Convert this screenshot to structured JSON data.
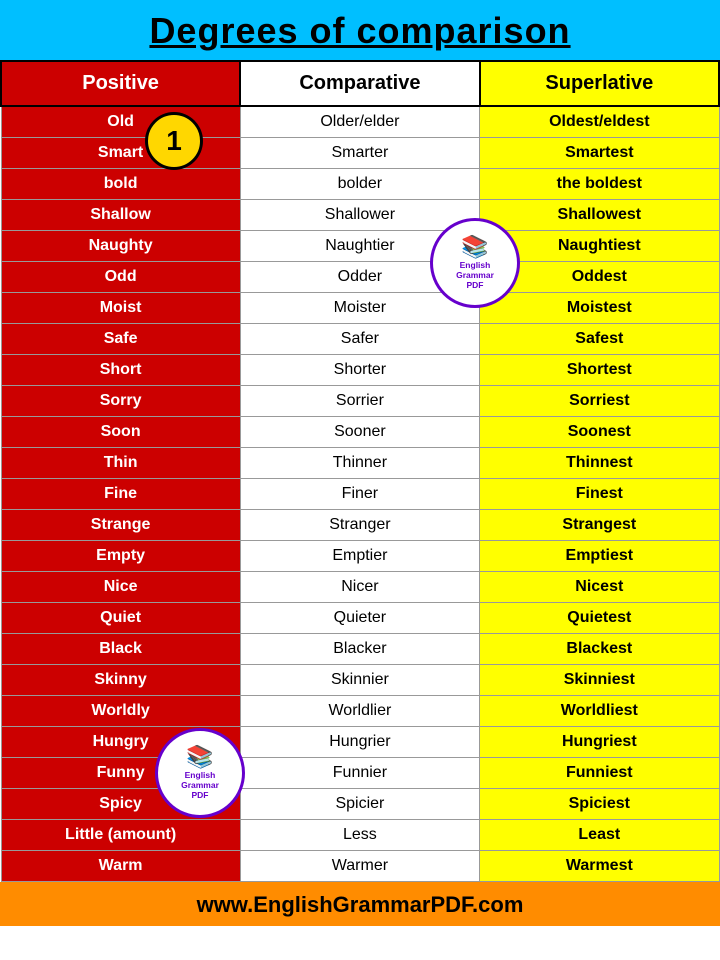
{
  "header": {
    "title": "Degrees of comparison"
  },
  "columns": {
    "positive": "Positive",
    "comparative": "Comparative",
    "superlative": "Superlative"
  },
  "rows": [
    {
      "positive": "Old",
      "comparative": "Older/elder",
      "superlative": "Oldest/eldest"
    },
    {
      "positive": "Smart",
      "comparative": "Smarter",
      "superlative": "Smartest"
    },
    {
      "positive": "bold",
      "comparative": "bolder",
      "superlative": "the boldest"
    },
    {
      "positive": "Shallow",
      "comparative": "Shallower",
      "superlative": "Shallowest"
    },
    {
      "positive": "Naughty",
      "comparative": "Naughtier",
      "superlative": "Naughtiest"
    },
    {
      "positive": "Odd",
      "comparative": "Odder",
      "superlative": "Oddest"
    },
    {
      "positive": "Moist",
      "comparative": "Moister",
      "superlative": "Moistest"
    },
    {
      "positive": "Safe",
      "comparative": "Safer",
      "superlative": "Safest"
    },
    {
      "positive": "Short",
      "comparative": "Shorter",
      "superlative": "Shortest"
    },
    {
      "positive": "Sorry",
      "comparative": "Sorrier",
      "superlative": "Sorriest"
    },
    {
      "positive": "Soon",
      "comparative": "Sooner",
      "superlative": "Soonest"
    },
    {
      "positive": "Thin",
      "comparative": "Thinner",
      "superlative": "Thinnest"
    },
    {
      "positive": "Fine",
      "comparative": "Finer",
      "superlative": "Finest"
    },
    {
      "positive": "Strange",
      "comparative": "Stranger",
      "superlative": "Strangest"
    },
    {
      "positive": "Empty",
      "comparative": "Emptier",
      "superlative": "Emptiest"
    },
    {
      "positive": "Nice",
      "comparative": "Nicer",
      "superlative": "Nicest"
    },
    {
      "positive": "Quiet",
      "comparative": "Quieter",
      "superlative": "Quietest"
    },
    {
      "positive": "Black",
      "comparative": "Blacker",
      "superlative": "Blackest"
    },
    {
      "positive": "Skinny",
      "comparative": "Skinnier",
      "superlative": "Skinniest"
    },
    {
      "positive": "Worldly",
      "comparative": "Worldlier",
      "superlative": "Worldliest"
    },
    {
      "positive": "Hungry",
      "comparative": "Hungrier",
      "superlative": "Hungriest"
    },
    {
      "positive": "Funny",
      "comparative": "Funnier",
      "superlative": "Funniest"
    },
    {
      "positive": "Spicy",
      "comparative": "Spicier",
      "superlative": "Spiciest"
    },
    {
      "positive": "Little (amount)",
      "comparative": "Less",
      "superlative": "Least"
    },
    {
      "positive": "Warm",
      "comparative": "Warmer",
      "superlative": "Warmest"
    }
  ],
  "badge": {
    "number": "1"
  },
  "stamp": {
    "line1": "English",
    "line2": "Grammar",
    "line3": "PDF",
    "icon": "📚"
  },
  "footer": {
    "url": "www.EnglishGrammarPDF.com"
  }
}
